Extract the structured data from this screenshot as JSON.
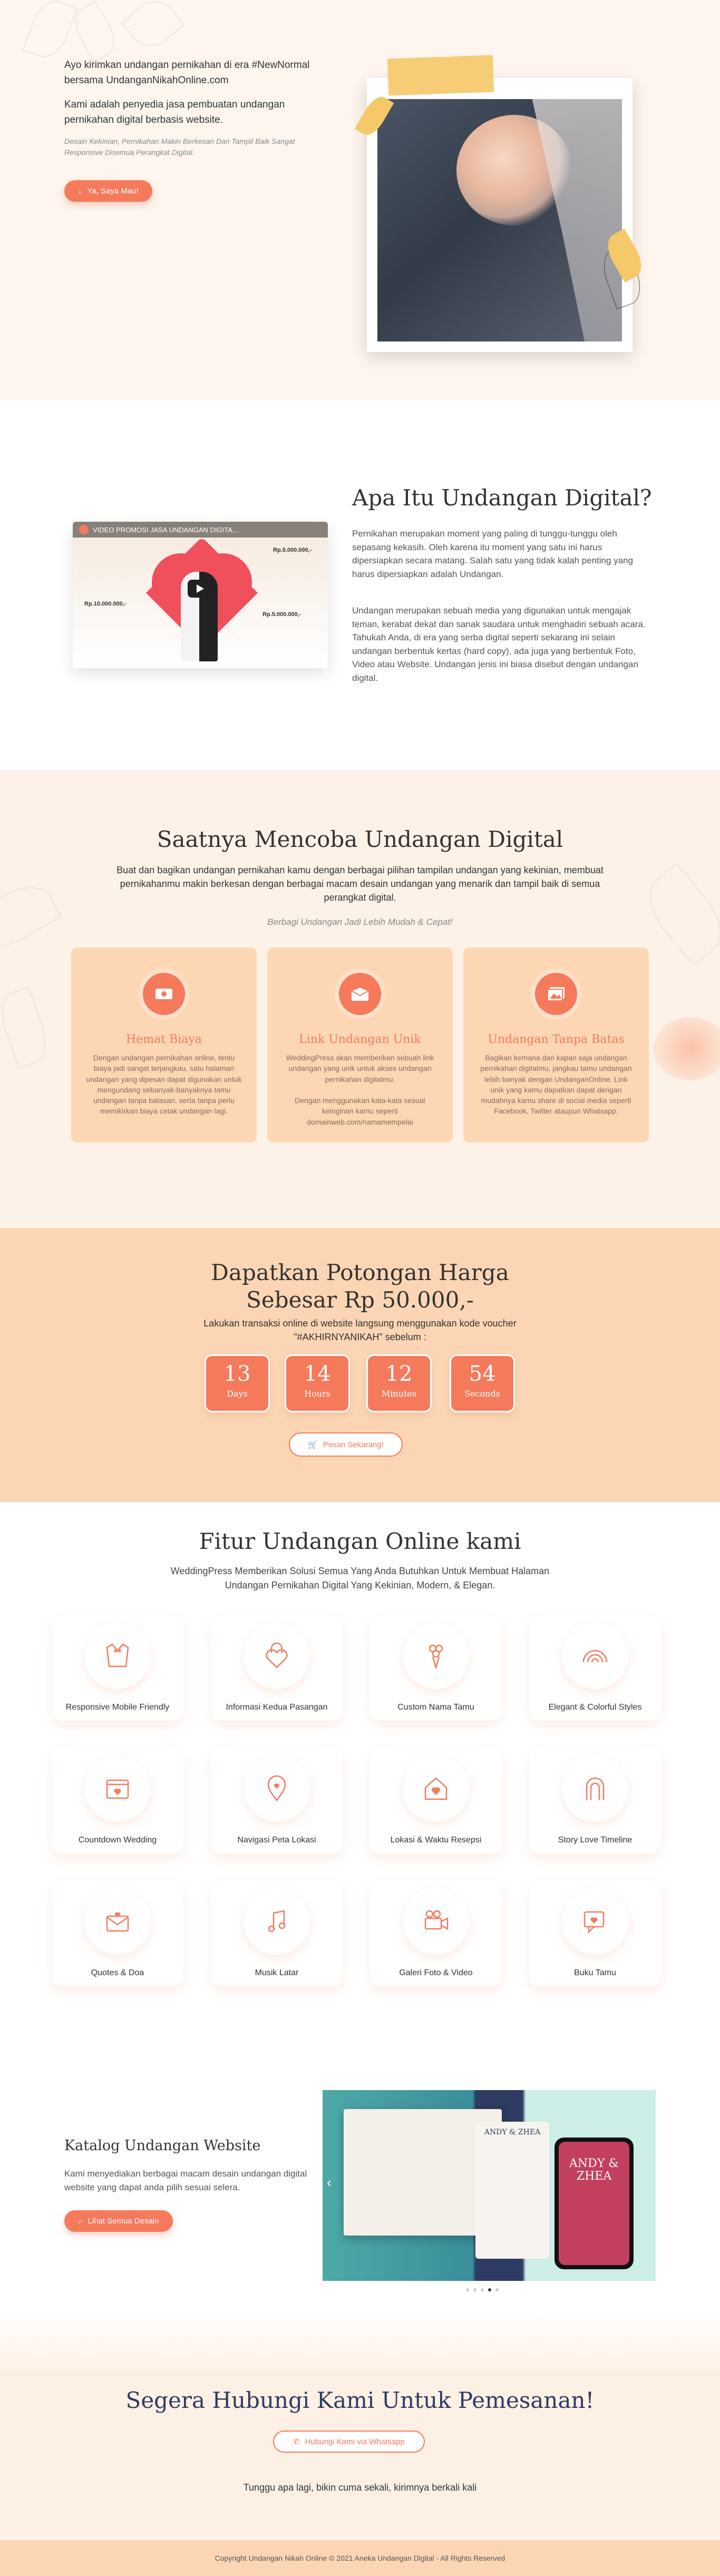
{
  "hero": {
    "line1": "Ayo kirimkan undangan pernikahan di era #NewNormal bersama UndanganNikahOnline.com",
    "line2": "Kami adalah penyedia jasa pembuatan undangan pernikahan digital berbasis website.",
    "subtitle": "Desain Kekinian, Pernikahan Makin Berkesan Dan Tampil Baik Sangat Responsive Disemua Perangkat Digital.",
    "cta": "Ya, Saya Mau!"
  },
  "about": {
    "title": "Apa Itu Undangan Digital?",
    "video_caption": "VIDEO PROMOSI JASA UNDANGAN DIGITA...",
    "video_price_1": "Rp.5.000.000,-",
    "video_price_2": "Rp.10.000.000,-",
    "video_price_3": "Rp.5.000.000,-",
    "p1": "Pernikahan merupakan moment yang paling di tunggu-tunggu oleh sepasang kekasih. Oleh karena itu moment yang satu ini harus dipersiapkan secara matang. Salah satu yang tidak kalah penting yang harus dipersiapkan adalah Undangan.",
    "p2": "Undangan merupakan sebuah media yang digunakan untuk mengajak teman, kerabat dekat dan sanak saudara untuk menghadiri sebuah acara. Tahukah Anda, di era yang serba digital seperti sekarang ini selain undangan berbentuk kertas (hard copy), ada juga yang berbentuk Foto, Video atau Website. Undangan jenis ini biasa disebut dengan undangan digital."
  },
  "try": {
    "title": "Saatnya Mencoba Undangan Digital",
    "desc": "Buat dan bagikan undangan pernikahan kamu dengan berbagai pilihan tampilan undangan yang kekinian, membuat pernikahanmu makin berkesan dengan berbagai macam desain undangan yang menarik dan tampil baik di semua perangkat digital.",
    "tagline": "Berbagi Undangan Jadi Lebih Mudah & Cepat!",
    "cards": [
      {
        "title": "Hemat Biaya",
        "text": "Dengan undangan pernikahan online, tentu biaya jadi sangat terjangkau, satu halaman undangan yang dipesan dapat digunakan untuk mengundang sebanyak-banyaknya tamu undangan tanpa batasan, serta tanpa perlu memikirkan biaya cetak undangan lagi.",
        "icon": "money-icon"
      },
      {
        "title": "Link Undangan Unik",
        "text": "WeddingPress akan memberikan sebuah link undangan yang unik untuk akses undangan pernikahan digitalmu.\n\nDengan menggunakan kata-kata sesuai keinginan kamu seperti domainweb.com/namamempelai",
        "icon": "mail-icon"
      },
      {
        "title": "Undangan Tanpa Batas",
        "text": "Bagikan kemana dan kapan saja undangan pernikahan digitalmu, jangkau tamu undangan lebih banyak dengan UndanganOnline. Link unik yang kamu dapatkan dapat dengan mudahnya kamu share di social media seperti Facebook, Twitter ataupun Whatsapp.",
        "icon": "gallery-icon"
      }
    ]
  },
  "promo": {
    "title_line1": "Dapatkan Potongan Harga",
    "title_line2": "Sebesar Rp 50.000,-",
    "desc": "Lakukan transaksi online di website langsung menggunakan kode voucher \"#AKHIRNYANIKAH\" sebelum :",
    "countdown": [
      {
        "value": "13",
        "label": "Days"
      },
      {
        "value": "14",
        "label": "Hours"
      },
      {
        "value": "12",
        "label": "Minutes"
      },
      {
        "value": "54",
        "label": "Seconds"
      }
    ],
    "cta": "Pesan Sekarang!"
  },
  "features": {
    "title": "Fitur Undangan Online kami",
    "desc": "WeddingPress Memberikan Solusi Semua Yang Anda Butuhkan Untuk Membuat Halaman Undangan Pernikahan Digital Yang Kekinian, Modern, & Elegan.",
    "items": [
      {
        "label": "Responsive Mobile Friendly",
        "icon": "tuxedo-icon"
      },
      {
        "label": "Informasi Kedua Pasangan",
        "icon": "heart-lock-icon"
      },
      {
        "label": "Custom Nama Tamu",
        "icon": "bouquet-icon"
      },
      {
        "label": "Elegant & Colorful Styles",
        "icon": "rainbow-icon"
      },
      {
        "label": "Countdown Wedding",
        "icon": "calendar-icon"
      },
      {
        "label": "Navigasi Peta Lokasi",
        "icon": "map-pin-icon"
      },
      {
        "label": "Lokasi & Waktu Resepsi",
        "icon": "house-heart-icon"
      },
      {
        "label": "Story Love Timeline",
        "icon": "arch-icon"
      },
      {
        "label": "Quotes & Doa",
        "icon": "envelope-heart-icon"
      },
      {
        "label": "Musik Latar",
        "icon": "music-icon"
      },
      {
        "label": "Galeri Foto & Video",
        "icon": "camera-icon"
      },
      {
        "label": "Buku Tamu",
        "icon": "chat-heart-icon"
      }
    ]
  },
  "catalog": {
    "title": "Katalog Undangan Website",
    "desc": "Kami menyediakan berbagai macam desain undangan digital website yang dapat anda pilih sesuai selera.",
    "cta": "Lihat Semua Desain",
    "preview_names": "ANDY & ZHEA"
  },
  "contact": {
    "title": "Segera Hubungi Kami Untuk Pemesanan!",
    "cta": "Hubungi Kami via Whatsapp",
    "note": "Tunggu apa lagi, bikin cuma sekali, kirimnya berkali kali"
  },
  "footer": {
    "copyright": "Copyright Undangan Nikah Online © 2021 Aneka Undangan Digital - All Rights Reserved"
  },
  "colors": {
    "accent": "#f57a5c",
    "peach": "#fdd7b4",
    "cream": "#fff4e8"
  }
}
